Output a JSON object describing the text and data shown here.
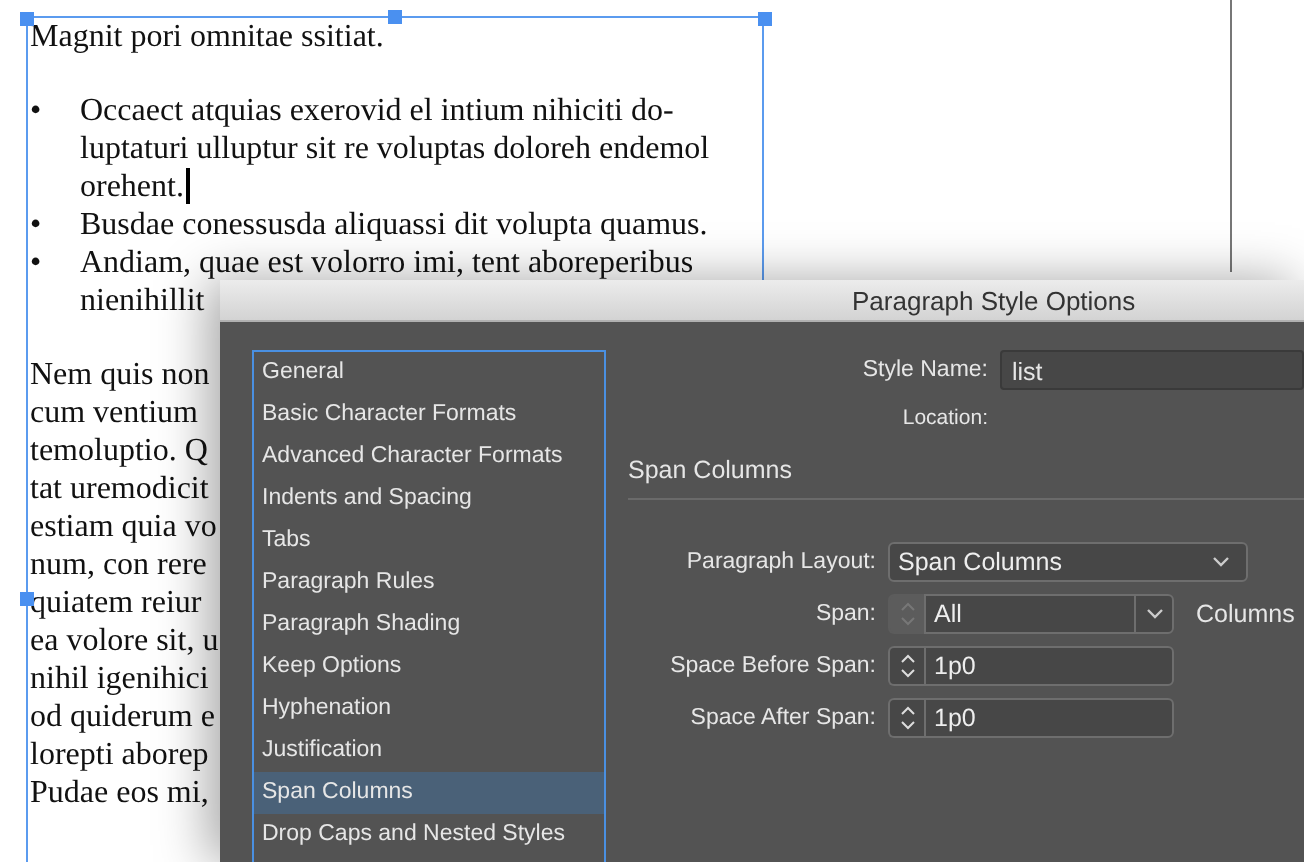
{
  "document": {
    "heading": "Magnit pori omnitae ssitiat.",
    "bullets": [
      {
        "marker": "•",
        "lines": [
          "Occaect atquias exerovid el intium nihiciti do-",
          "luptaturi ulluptur sit re voluptas doloreh endemol",
          "orehent."
        ],
        "has_cursor": true
      },
      {
        "marker": "•",
        "lines": [
          "Busdae conessusda aliquassi dit volupta quamus."
        ],
        "has_cursor": false
      },
      {
        "marker": "•",
        "lines": [
          "Andiam, quae est volorro imi, tent aboreperibus",
          "nienihillit"
        ],
        "has_cursor": false
      }
    ],
    "paragraph_lines": [
      "Nem quis non",
      "cum ventium",
      "temoluptio. Q",
      "tat uremodicit",
      "estiam quia vo",
      "num, con rere",
      "quiatem reiur",
      "ea volore sit, u",
      "nihil igenihici",
      "od quiderum e",
      "lorepti aborep",
      "Pudae eos mi,"
    ]
  },
  "dialog": {
    "title": "Paragraph Style Options",
    "categories": [
      {
        "label": "General",
        "selected": false
      },
      {
        "label": "Basic Character Formats",
        "selected": false
      },
      {
        "label": "Advanced Character Formats",
        "selected": false
      },
      {
        "label": "Indents and Spacing",
        "selected": false
      },
      {
        "label": "Tabs",
        "selected": false
      },
      {
        "label": "Paragraph Rules",
        "selected": false
      },
      {
        "label": "Paragraph Shading",
        "selected": false
      },
      {
        "label": "Keep Options",
        "selected": false
      },
      {
        "label": "Hyphenation",
        "selected": false
      },
      {
        "label": "Justification",
        "selected": false
      },
      {
        "label": "Span Columns",
        "selected": true
      },
      {
        "label": "Drop Caps and Nested Styles",
        "selected": false
      }
    ],
    "style_name": {
      "label": "Style Name:",
      "value": "list"
    },
    "location": {
      "label": "Location:"
    },
    "section_title": "Span Columns",
    "fields": [
      {
        "kind": "select",
        "label": "Paragraph Layout:",
        "value": "Span Columns"
      },
      {
        "kind": "spin-select",
        "label": "Span:",
        "value": "All",
        "spinner_disabled": true,
        "unit": "Columns"
      },
      {
        "kind": "spin",
        "label": "Space Before Span:",
        "value": "1p0",
        "spinner_disabled": false
      },
      {
        "kind": "spin",
        "label": "Space After Span:",
        "value": "1p0",
        "spinner_disabled": false
      }
    ]
  }
}
